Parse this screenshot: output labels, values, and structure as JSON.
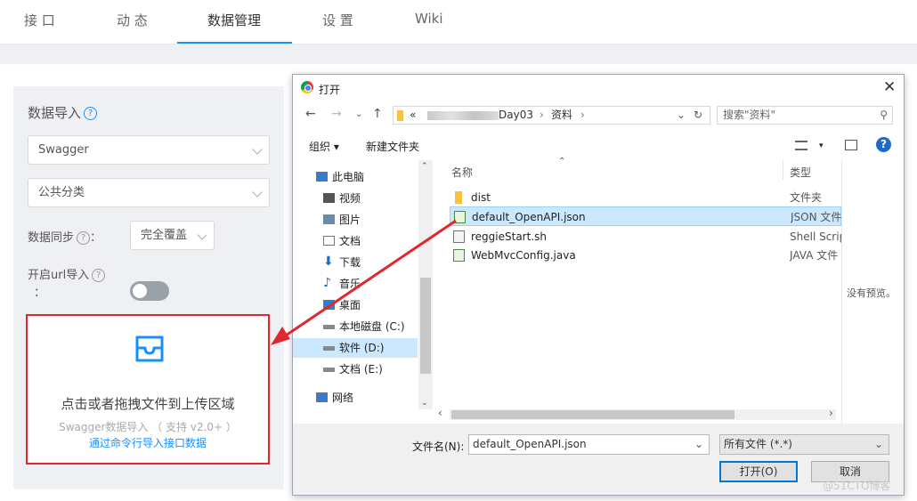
{
  "nav": {
    "tabs": [
      "接 口",
      "动 态",
      "数据管理",
      "设 置",
      "Wiki"
    ],
    "active": "数据管理"
  },
  "import_panel": {
    "title": "数据导入",
    "source_select": "Swagger",
    "category_select": "公共分类",
    "sync_label": "数据同步",
    "sync_select": "完全覆盖",
    "url_import_label": "开启url导入",
    "url_import_colon": "：",
    "sync_colon": "：",
    "url_toggle": "off",
    "upload": {
      "main_text": "点击或者拖拽文件到上传区域",
      "sub_text": "Swagger数据导入 （ 支持 v2.0+ ）",
      "link_text": "通过命令行导入接口数据"
    }
  },
  "file_dialog": {
    "title": "打开",
    "path_prefix": "«",
    "path_segment_1": "Day03",
    "path_segment_2": "资料",
    "search_placeholder": "搜索\"资料\"",
    "organize": "组织 ▾",
    "new_folder": "新建文件夹",
    "tree": [
      {
        "label": "此电脑"
      },
      {
        "label": "视频"
      },
      {
        "label": "图片"
      },
      {
        "label": "文档"
      },
      {
        "label": "下载"
      },
      {
        "label": "音乐"
      },
      {
        "label": "桌面"
      },
      {
        "label": "本地磁盘 (C:)"
      },
      {
        "label": "软件 (D:)",
        "selected": true
      },
      {
        "label": "文档 (E:)"
      },
      {
        "label": "网络"
      }
    ],
    "columns": {
      "name": "名称",
      "type": "类型"
    },
    "files": [
      {
        "name": "dist",
        "type": "文件夹",
        "icon": "folder-icon"
      },
      {
        "name": "default_OpenAPI.json",
        "type": "JSON 文件",
        "icon": "json-file-icon",
        "selected": true
      },
      {
        "name": "reggieStart.sh",
        "type": "Shell Script",
        "icon": "script-file-icon"
      },
      {
        "name": "WebMvcConfig.java",
        "type": "JAVA 文件",
        "icon": "java-file-icon"
      }
    ],
    "no_preview": "没有预览。",
    "filename_label": "文件名(N):",
    "filename_value": "default_OpenAPI.json",
    "filetype_value": "所有文件 (*.*)",
    "open_button": "打开(O)",
    "cancel_button": "取消"
  },
  "watermark": "@51CTO博客",
  "colors": {
    "accent": "#1890ff",
    "highlight_border": "#e0272d",
    "selection": "#cce8ff"
  }
}
